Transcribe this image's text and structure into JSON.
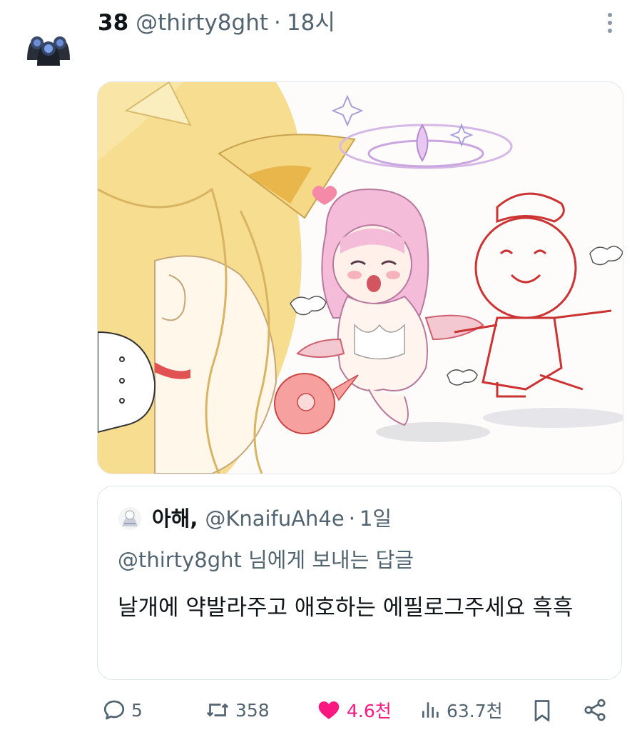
{
  "post": {
    "author": {
      "display_name": "38",
      "handle": "@thirty8ght",
      "separator": "·",
      "time": "18시"
    },
    "media": {
      "speech_bubble_text": "。。。"
    },
    "quote": {
      "author": {
        "display_name": "아해,",
        "handle": "@KnaifuAh4e",
        "separator": "·",
        "time": "1일"
      },
      "reply_context": "@thirty8ght 님에게 보내는 답글",
      "text": "날개에 약발라주고 애호하는 에필로그주세요 흑흑"
    },
    "actions": {
      "replies": "5",
      "reposts": "358",
      "likes": "4.6천",
      "views": "63.7천"
    }
  },
  "colors": {
    "like_active": "#f91880",
    "secondary_text": "#536471",
    "primary_text": "#0f1419"
  }
}
